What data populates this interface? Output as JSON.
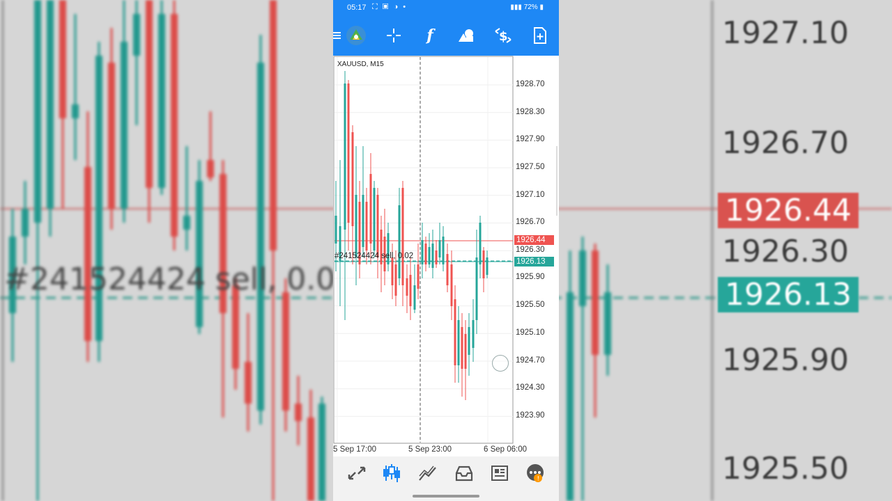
{
  "status": {
    "time": "05:17",
    "battery": "72%"
  },
  "chart": {
    "symbol": "XAUUSD, M15",
    "price_levels": [
      "1928.70",
      "1928.30",
      "1927.90",
      "1927.50",
      "1927.10",
      "1926.70",
      "1926.30",
      "1925.90",
      "1925.50",
      "1925.10",
      "1924.70",
      "1924.30",
      "1923.90"
    ],
    "time_labels": [
      "5 Sep 17:00",
      "5 Sep 23:00",
      "6 Sep 06:00"
    ],
    "ask_price": "1926.44",
    "bid_price": "1926.13",
    "trade_label": "#241524424 sell, 0.02",
    "colors": {
      "bull": "#26a69a",
      "bear": "#ef5350",
      "accent": "#1e88f5"
    }
  },
  "toolbar": {
    "icons": [
      "menu-icon",
      "app-logo-icon",
      "crosshair-icon",
      "indicators-icon",
      "objects-icon",
      "trade-icon",
      "new-order-icon"
    ],
    "indicator_glyph": "f"
  },
  "navbar": {
    "icons": [
      "quotes-icon",
      "chart-icon",
      "trade-icon",
      "history-icon",
      "news-icon",
      "chat-icon"
    ],
    "chat_badge": "!"
  },
  "background": {
    "price_levels": [
      "1927.10",
      "1926.70",
      "1926.30",
      "1925.90",
      "1925.50"
    ],
    "ask_price": "1926.44",
    "bid_price": "1926.13",
    "trade_label": "#241524424 sell, 0.0"
  }
}
